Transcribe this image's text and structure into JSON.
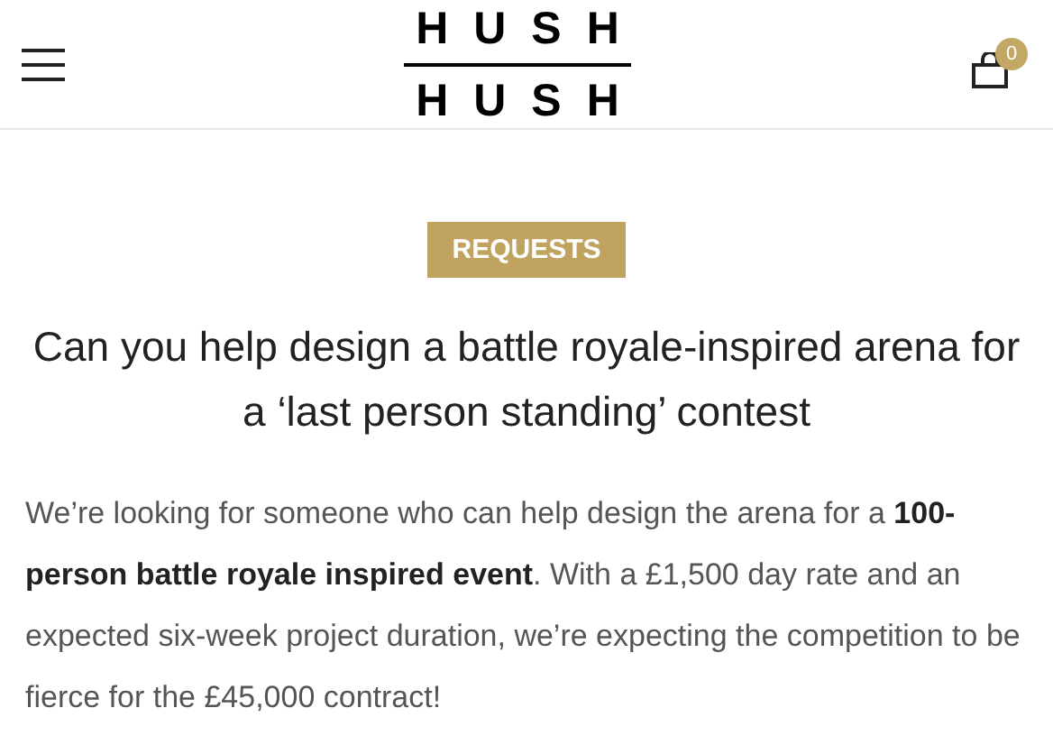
{
  "header": {
    "logo_top": "HUSH",
    "logo_bottom": "HUSH",
    "cart_count": "0"
  },
  "category": "REQUESTS",
  "title": "Can you help design a battle royale-inspired arena for a ‘last person standing’ contest",
  "body": "We’re looking for someone who can help design the arena for a **100-person battle royale inspired event**. With a £1,500 day rate and an expected six-week project duration, we’re expecting the competition to be fierce for the £45,000 contract!"
}
